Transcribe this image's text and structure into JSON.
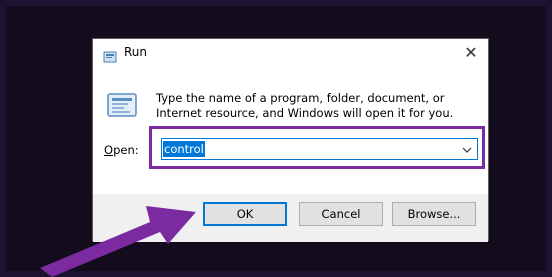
{
  "dialog": {
    "title": "Run",
    "close_glyph": "✕",
    "description": "Type the name of a program, folder, document, or Internet resource, and Windows will open it for you.",
    "open_label_accel": "O",
    "open_label_rest": "pen:",
    "open_value": "control",
    "buttons": {
      "ok": "OK",
      "cancel": "Cancel",
      "browse": "Browse..."
    }
  },
  "colors": {
    "accent": "#0078d7",
    "highlight": "#7b2aa0",
    "arrow": "#7b2aa0"
  },
  "icons": [
    "run-icon",
    "close-icon",
    "run-large-icon",
    "chevron-down-icon",
    "pointer-arrow"
  ]
}
